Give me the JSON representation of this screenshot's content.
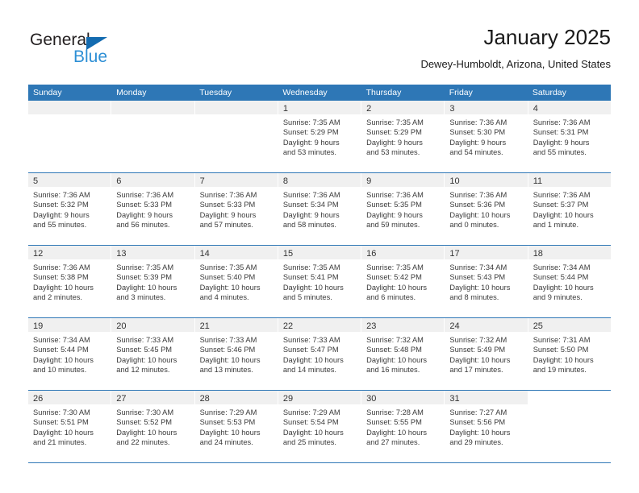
{
  "logo": {
    "word_top": "General",
    "word_bottom": "Blue",
    "triangle_color": "#136bb0",
    "blue_color": "#2d8fd5"
  },
  "header": {
    "title": "January 2025",
    "subtitle": "Dewey-Humboldt, Arizona, United States"
  },
  "theme": {
    "header_bar_color": "#2e77b6",
    "day_band_color": "#f0f0f0",
    "row_separator_color": "#2e77b6"
  },
  "weekday_headers": [
    "Sunday",
    "Monday",
    "Tuesday",
    "Wednesday",
    "Thursday",
    "Friday",
    "Saturday"
  ],
  "weeks": [
    [
      {
        "day": "",
        "empty": true
      },
      {
        "day": "",
        "empty": true
      },
      {
        "day": "",
        "empty": true
      },
      {
        "day": "1",
        "sunrise": "Sunrise: 7:35 AM",
        "sunset": "Sunset: 5:29 PM",
        "daylight1": "Daylight: 9 hours",
        "daylight2": "and 53 minutes."
      },
      {
        "day": "2",
        "sunrise": "Sunrise: 7:35 AM",
        "sunset": "Sunset: 5:29 PM",
        "daylight1": "Daylight: 9 hours",
        "daylight2": "and 53 minutes."
      },
      {
        "day": "3",
        "sunrise": "Sunrise: 7:36 AM",
        "sunset": "Sunset: 5:30 PM",
        "daylight1": "Daylight: 9 hours",
        "daylight2": "and 54 minutes."
      },
      {
        "day": "4",
        "sunrise": "Sunrise: 7:36 AM",
        "sunset": "Sunset: 5:31 PM",
        "daylight1": "Daylight: 9 hours",
        "daylight2": "and 55 minutes."
      }
    ],
    [
      {
        "day": "5",
        "sunrise": "Sunrise: 7:36 AM",
        "sunset": "Sunset: 5:32 PM",
        "daylight1": "Daylight: 9 hours",
        "daylight2": "and 55 minutes."
      },
      {
        "day": "6",
        "sunrise": "Sunrise: 7:36 AM",
        "sunset": "Sunset: 5:33 PM",
        "daylight1": "Daylight: 9 hours",
        "daylight2": "and 56 minutes."
      },
      {
        "day": "7",
        "sunrise": "Sunrise: 7:36 AM",
        "sunset": "Sunset: 5:33 PM",
        "daylight1": "Daylight: 9 hours",
        "daylight2": "and 57 minutes."
      },
      {
        "day": "8",
        "sunrise": "Sunrise: 7:36 AM",
        "sunset": "Sunset: 5:34 PM",
        "daylight1": "Daylight: 9 hours",
        "daylight2": "and 58 minutes."
      },
      {
        "day": "9",
        "sunrise": "Sunrise: 7:36 AM",
        "sunset": "Sunset: 5:35 PM",
        "daylight1": "Daylight: 9 hours",
        "daylight2": "and 59 minutes."
      },
      {
        "day": "10",
        "sunrise": "Sunrise: 7:36 AM",
        "sunset": "Sunset: 5:36 PM",
        "daylight1": "Daylight: 10 hours",
        "daylight2": "and 0 minutes."
      },
      {
        "day": "11",
        "sunrise": "Sunrise: 7:36 AM",
        "sunset": "Sunset: 5:37 PM",
        "daylight1": "Daylight: 10 hours",
        "daylight2": "and 1 minute."
      }
    ],
    [
      {
        "day": "12",
        "sunrise": "Sunrise: 7:36 AM",
        "sunset": "Sunset: 5:38 PM",
        "daylight1": "Daylight: 10 hours",
        "daylight2": "and 2 minutes."
      },
      {
        "day": "13",
        "sunrise": "Sunrise: 7:35 AM",
        "sunset": "Sunset: 5:39 PM",
        "daylight1": "Daylight: 10 hours",
        "daylight2": "and 3 minutes."
      },
      {
        "day": "14",
        "sunrise": "Sunrise: 7:35 AM",
        "sunset": "Sunset: 5:40 PM",
        "daylight1": "Daylight: 10 hours",
        "daylight2": "and 4 minutes."
      },
      {
        "day": "15",
        "sunrise": "Sunrise: 7:35 AM",
        "sunset": "Sunset: 5:41 PM",
        "daylight1": "Daylight: 10 hours",
        "daylight2": "and 5 minutes."
      },
      {
        "day": "16",
        "sunrise": "Sunrise: 7:35 AM",
        "sunset": "Sunset: 5:42 PM",
        "daylight1": "Daylight: 10 hours",
        "daylight2": "and 6 minutes."
      },
      {
        "day": "17",
        "sunrise": "Sunrise: 7:34 AM",
        "sunset": "Sunset: 5:43 PM",
        "daylight1": "Daylight: 10 hours",
        "daylight2": "and 8 minutes."
      },
      {
        "day": "18",
        "sunrise": "Sunrise: 7:34 AM",
        "sunset": "Sunset: 5:44 PM",
        "daylight1": "Daylight: 10 hours",
        "daylight2": "and 9 minutes."
      }
    ],
    [
      {
        "day": "19",
        "sunrise": "Sunrise: 7:34 AM",
        "sunset": "Sunset: 5:44 PM",
        "daylight1": "Daylight: 10 hours",
        "daylight2": "and 10 minutes."
      },
      {
        "day": "20",
        "sunrise": "Sunrise: 7:33 AM",
        "sunset": "Sunset: 5:45 PM",
        "daylight1": "Daylight: 10 hours",
        "daylight2": "and 12 minutes."
      },
      {
        "day": "21",
        "sunrise": "Sunrise: 7:33 AM",
        "sunset": "Sunset: 5:46 PM",
        "daylight1": "Daylight: 10 hours",
        "daylight2": "and 13 minutes."
      },
      {
        "day": "22",
        "sunrise": "Sunrise: 7:33 AM",
        "sunset": "Sunset: 5:47 PM",
        "daylight1": "Daylight: 10 hours",
        "daylight2": "and 14 minutes."
      },
      {
        "day": "23",
        "sunrise": "Sunrise: 7:32 AM",
        "sunset": "Sunset: 5:48 PM",
        "daylight1": "Daylight: 10 hours",
        "daylight2": "and 16 minutes."
      },
      {
        "day": "24",
        "sunrise": "Sunrise: 7:32 AM",
        "sunset": "Sunset: 5:49 PM",
        "daylight1": "Daylight: 10 hours",
        "daylight2": "and 17 minutes."
      },
      {
        "day": "25",
        "sunrise": "Sunrise: 7:31 AM",
        "sunset": "Sunset: 5:50 PM",
        "daylight1": "Daylight: 10 hours",
        "daylight2": "and 19 minutes."
      }
    ],
    [
      {
        "day": "26",
        "sunrise": "Sunrise: 7:30 AM",
        "sunset": "Sunset: 5:51 PM",
        "daylight1": "Daylight: 10 hours",
        "daylight2": "and 21 minutes."
      },
      {
        "day": "27",
        "sunrise": "Sunrise: 7:30 AM",
        "sunset": "Sunset: 5:52 PM",
        "daylight1": "Daylight: 10 hours",
        "daylight2": "and 22 minutes."
      },
      {
        "day": "28",
        "sunrise": "Sunrise: 7:29 AM",
        "sunset": "Sunset: 5:53 PM",
        "daylight1": "Daylight: 10 hours",
        "daylight2": "and 24 minutes."
      },
      {
        "day": "29",
        "sunrise": "Sunrise: 7:29 AM",
        "sunset": "Sunset: 5:54 PM",
        "daylight1": "Daylight: 10 hours",
        "daylight2": "and 25 minutes."
      },
      {
        "day": "30",
        "sunrise": "Sunrise: 7:28 AM",
        "sunset": "Sunset: 5:55 PM",
        "daylight1": "Daylight: 10 hours",
        "daylight2": "and 27 minutes."
      },
      {
        "day": "31",
        "sunrise": "Sunrise: 7:27 AM",
        "sunset": "Sunset: 5:56 PM",
        "daylight1": "Daylight: 10 hours",
        "daylight2": "and 29 minutes."
      },
      {
        "day": "",
        "empty": true,
        "noband": true
      }
    ]
  ]
}
